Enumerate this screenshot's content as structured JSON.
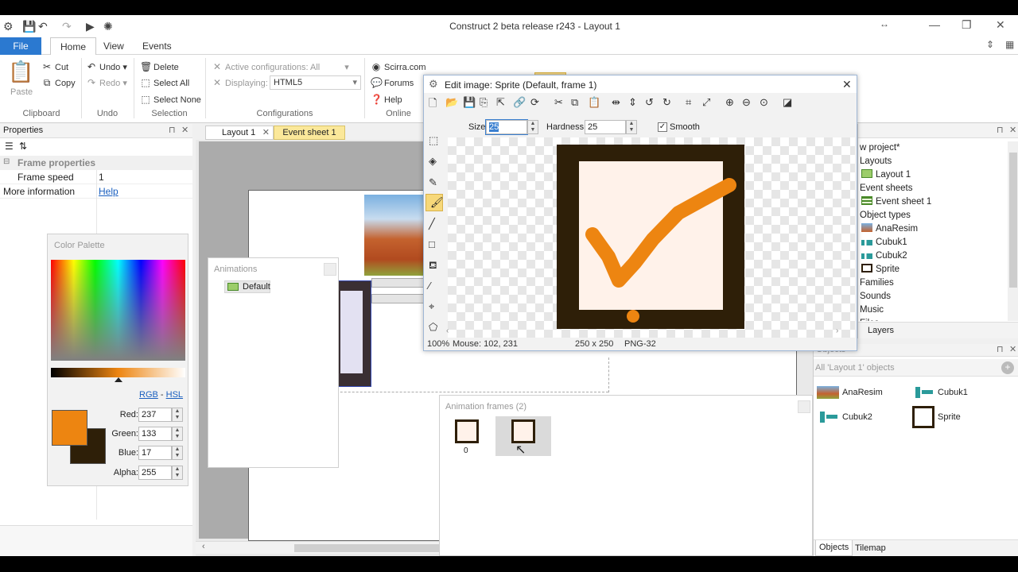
{
  "window": {
    "title": "Construct 2 beta release r243 - Layout 1"
  },
  "ribbon": {
    "tabs": [
      "File",
      "Home",
      "View",
      "Events"
    ],
    "clipboard": {
      "paste": "Paste",
      "cut": "Cut",
      "copy": "Copy",
      "label": "Clipboard"
    },
    "undo": {
      "undo": "Undo",
      "redo": "Redo",
      "label": "Undo"
    },
    "selection": {
      "delete": "Delete",
      "select_all": "Select All",
      "select_none": "Select None",
      "label": "Selection"
    },
    "configurations": {
      "active_label": "Active configurations: All",
      "displaying_label": "Displaying:",
      "displaying_value": "HTML5",
      "label": "Configurations"
    },
    "online": {
      "scirra": "Scirra.com",
      "forums": "Forums",
      "help": "Help",
      "label": "Online"
    }
  },
  "properties": {
    "title": "Properties",
    "section": "Frame properties",
    "rows": [
      {
        "name": "Frame speed",
        "value": "1"
      },
      {
        "name": "More information",
        "value": "Help"
      }
    ]
  },
  "color_palette": {
    "title": "Color Palette",
    "mode_rgb": "RGB",
    "mode_sep": "-",
    "mode_hsl": "HSL",
    "fields": [
      {
        "label": "Red:",
        "value": "237"
      },
      {
        "label": "Green:",
        "value": "133"
      },
      {
        "label": "Blue:",
        "value": "17"
      },
      {
        "label": "Alpha:",
        "value": "255"
      }
    ],
    "primary_color": "#ed8511",
    "secondary_color": "#2e1f08"
  },
  "doc_tabs": [
    "Layout 1",
    "Event sheet 1"
  ],
  "animations": {
    "title": "Animations",
    "items": [
      "Default"
    ]
  },
  "animation_frames": {
    "title": "Animation frames (2)",
    "frames": [
      "0",
      ""
    ]
  },
  "edit_image": {
    "title": "Edit image: Sprite (Default, frame 1)",
    "size_label": "Size",
    "size_value": "25",
    "hardness_label": "Hardness",
    "hardness_value": "25",
    "smooth_label": "Smooth",
    "status_zoom": "100%",
    "status_mouse": "Mouse: 102, 231",
    "status_dims": "250 x 250",
    "status_format": "PNG-32"
  },
  "project": {
    "items": [
      {
        "label": "w project*",
        "icon": "none"
      },
      {
        "label": "Layouts",
        "icon": "none"
      },
      {
        "label": "Layout 1",
        "icon": "layout"
      },
      {
        "label": "Event sheets",
        "icon": "none"
      },
      {
        "label": "Event sheet 1",
        "icon": "events"
      },
      {
        "label": "Object types",
        "icon": "none"
      },
      {
        "label": "AnaResim",
        "icon": "image"
      },
      {
        "label": "Cubuk1",
        "icon": "bar"
      },
      {
        "label": "Cubuk2",
        "icon": "bar"
      },
      {
        "label": "Sprite",
        "icon": "sprite"
      },
      {
        "label": "Families",
        "icon": "none"
      },
      {
        "label": "Sounds",
        "icon": "none"
      },
      {
        "label": "Music",
        "icon": "none"
      },
      {
        "label": "Files",
        "icon": "none"
      }
    ],
    "layers_tab": "Layers"
  },
  "objects": {
    "title": "Objects",
    "filter": "All 'Layout 1' objects",
    "items": [
      {
        "label": "AnaResim",
        "icon": "image"
      },
      {
        "label": "Cubuk1",
        "icon": "bar"
      },
      {
        "label": "Cubuk2",
        "icon": "bar"
      },
      {
        "label": "Sprite",
        "icon": "sprite"
      }
    ],
    "bottom_tabs": [
      "Objects",
      "Tilemap"
    ]
  },
  "colors": {
    "accent": "#2b79d0",
    "brush": "#ed8511",
    "frame": "#2e1f08",
    "sprite_bg": "#fff2ea"
  }
}
